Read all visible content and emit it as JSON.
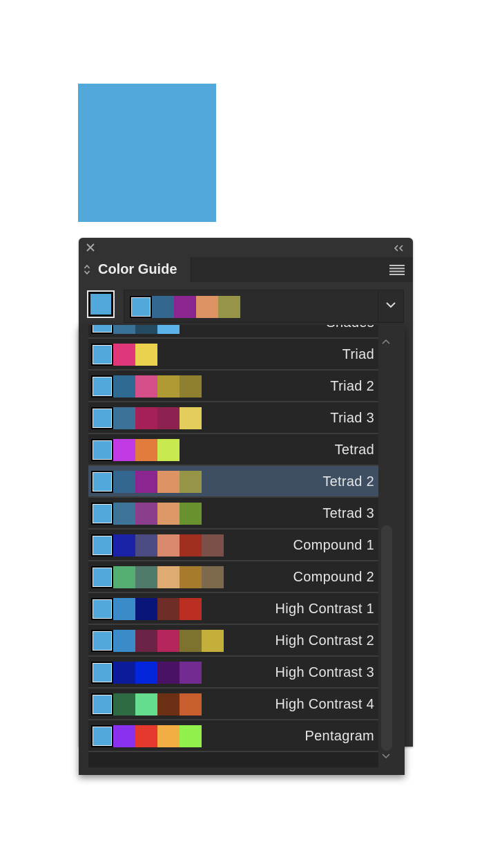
{
  "canvas": {
    "square_color": "#52A7DB"
  },
  "panel": {
    "title": "Color Guide",
    "icons": {
      "close": "close-icon",
      "collapse": "double-chevron-left-icon",
      "tab_arrows": "updown-icon",
      "menu": "hamburger-menu-icon",
      "dropdown": "chevron-down-icon"
    },
    "current_color": "#52A7DB",
    "selected_harmony_colors": [
      "#52A7DB",
      "#33678F",
      "#8B2590",
      "#DE9365",
      "#959447"
    ]
  },
  "harmony_rules": [
    {
      "label": "Shades",
      "colors": [
        "#52A7DB",
        "#3A7297",
        "#254B63",
        "#5BB3E9"
      ],
      "selected": false
    },
    {
      "label": "Triad",
      "colors": [
        "#52A7DB",
        "#E0377B",
        "#EAD14E"
      ],
      "selected": false
    },
    {
      "label": "Triad 2",
      "colors": [
        "#52A7DB",
        "#2E6A91",
        "#D54E89",
        "#AF9A33",
        "#8E7F31"
      ],
      "selected": false
    },
    {
      "label": "Triad 3",
      "colors": [
        "#52A7DB",
        "#3D7298",
        "#A52056",
        "#8D2150",
        "#E3CE5C"
      ],
      "selected": false
    },
    {
      "label": "Tetrad",
      "colors": [
        "#52A7DB",
        "#C03BE3",
        "#E27C3C",
        "#C8EA4F"
      ],
      "selected": false
    },
    {
      "label": "Tetrad 2",
      "colors": [
        "#52A7DB",
        "#33678F",
        "#8B2590",
        "#DE9365",
        "#959447"
      ],
      "selected": true
    },
    {
      "label": "Tetrad 3",
      "colors": [
        "#52A7DB",
        "#3F7499",
        "#8A3E8B",
        "#DC9866",
        "#67922F"
      ],
      "selected": false
    },
    {
      "label": "Compound 1",
      "colors": [
        "#52A7DB",
        "#1A23A8",
        "#4B4C82",
        "#D98A6D",
        "#A12F20",
        "#7A5048"
      ],
      "selected": false
    },
    {
      "label": "Compound 2",
      "colors": [
        "#52A7DB",
        "#55AE71",
        "#507A6A",
        "#DEAB72",
        "#A67C2C",
        "#7D6A4C"
      ],
      "selected": false
    },
    {
      "label": "High Contrast 1",
      "colors": [
        "#52A7DB",
        "#3B8BC9",
        "#0A157A",
        "#6E2D27",
        "#BB2E22"
      ],
      "selected": false
    },
    {
      "label": "High Contrast 2",
      "colors": [
        "#52A7DB",
        "#3B8BC9",
        "#6C2446",
        "#B5275C",
        "#7D722E",
        "#C3AF3A"
      ],
      "selected": false
    },
    {
      "label": "High Contrast 3",
      "colors": [
        "#52A7DB",
        "#0C1B99",
        "#0325DC",
        "#4A1262",
        "#722C91"
      ],
      "selected": false
    },
    {
      "label": "High Contrast 4",
      "colors": [
        "#52A7DB",
        "#2E6B45",
        "#66DD8E",
        "#6E3015",
        "#C85D2D"
      ],
      "selected": false
    },
    {
      "label": "Pentagram",
      "colors": [
        "#52A7DB",
        "#8A31F0",
        "#E4392C",
        "#F0AE44",
        "#91F04C"
      ],
      "selected": false
    }
  ]
}
